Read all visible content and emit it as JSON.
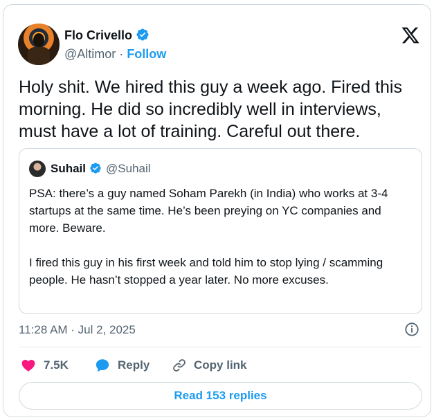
{
  "author": {
    "name": "Flo Crivello",
    "handle": "@Altimor",
    "separator": "·",
    "follow_label": "Follow",
    "verified": true
  },
  "tweet": {
    "text": "Holy shit. We hired this guy a week ago. Fired this morning. He did so incredibly well in interviews, must have a lot of training. Careful out there."
  },
  "quote": {
    "name": "Suhail",
    "handle": "@Suhail",
    "verified": true,
    "paragraphs": [
      "PSA: there’s a guy named Soham Parekh (in India) who works at 3-4 startups at the same time. He’s been preying on YC companies and more. Beware.",
      "I fired this guy in his first week and told him to stop lying / scamming people. He hasn’t stopped a year later. No more excuses."
    ]
  },
  "meta": {
    "timestamp": "11:28 AM · Jul 2, 2025"
  },
  "actions": {
    "likes": "7.5K",
    "reply_label": "Reply",
    "copy_link_label": "Copy link"
  },
  "read_replies_label": "Read 153 replies",
  "colors": {
    "accent": "#1d9bf0",
    "like": "#f91880",
    "text": "#0f1419",
    "secondary": "#536471",
    "border": "#cfd9de"
  },
  "icons": [
    "verified-badge-icon",
    "x-logo-icon",
    "info-icon",
    "heart-icon",
    "reply-bubble-icon",
    "link-icon"
  ]
}
